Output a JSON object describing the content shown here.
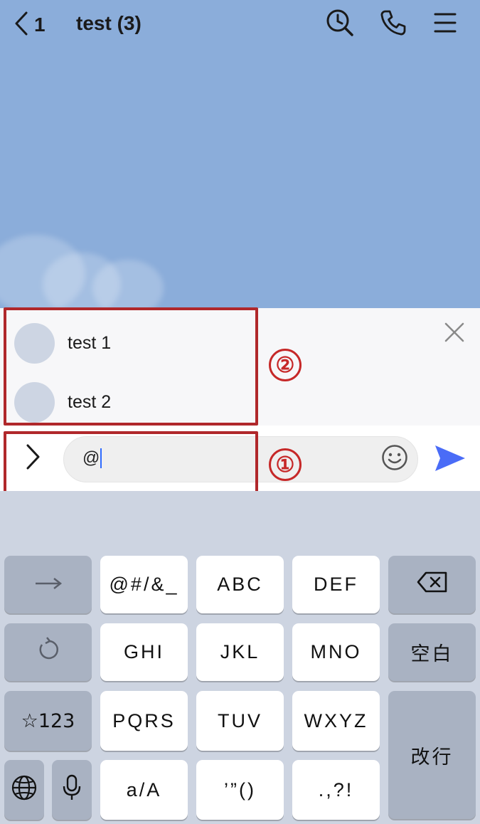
{
  "header": {
    "back_count": "1",
    "title": "test (3)"
  },
  "mention_list": {
    "items": [
      {
        "name": "test 1"
      },
      {
        "name": "test 2"
      }
    ]
  },
  "composer": {
    "input_value": "@"
  },
  "annotations": {
    "label_1": "①",
    "label_2": "②",
    "color": "#b0282b"
  },
  "keyboard": {
    "rows": [
      [
        "→",
        "@#/&_",
        "ABC",
        "DEF",
        "backspace-icon"
      ],
      [
        "undo-icon",
        "GHI",
        "JKL",
        "MNO",
        "空白"
      ],
      [
        "☆123",
        "PQRS",
        "TUV",
        "WXYZ",
        "改行"
      ],
      [
        "globe-icon",
        "mic-icon",
        "a/A",
        "’”()",
        ".,?!"
      ]
    ],
    "labels": {
      "arrow": "→",
      "symbols": "@#/&_",
      "abc": "ABC",
      "def": "DEF",
      "ghi": "GHI",
      "jkl": "JKL",
      "mno": "MNO",
      "space": "空白",
      "num": "☆123",
      "pqrs": "PQRS",
      "tuv": "TUV",
      "wxyz": "WXYZ",
      "enter": "改行",
      "case": "a/A",
      "quotes": "’”()",
      "punct": ".,?!"
    }
  },
  "colors": {
    "chat_background": "#8badda",
    "send_accent": "#4a6cf7"
  }
}
